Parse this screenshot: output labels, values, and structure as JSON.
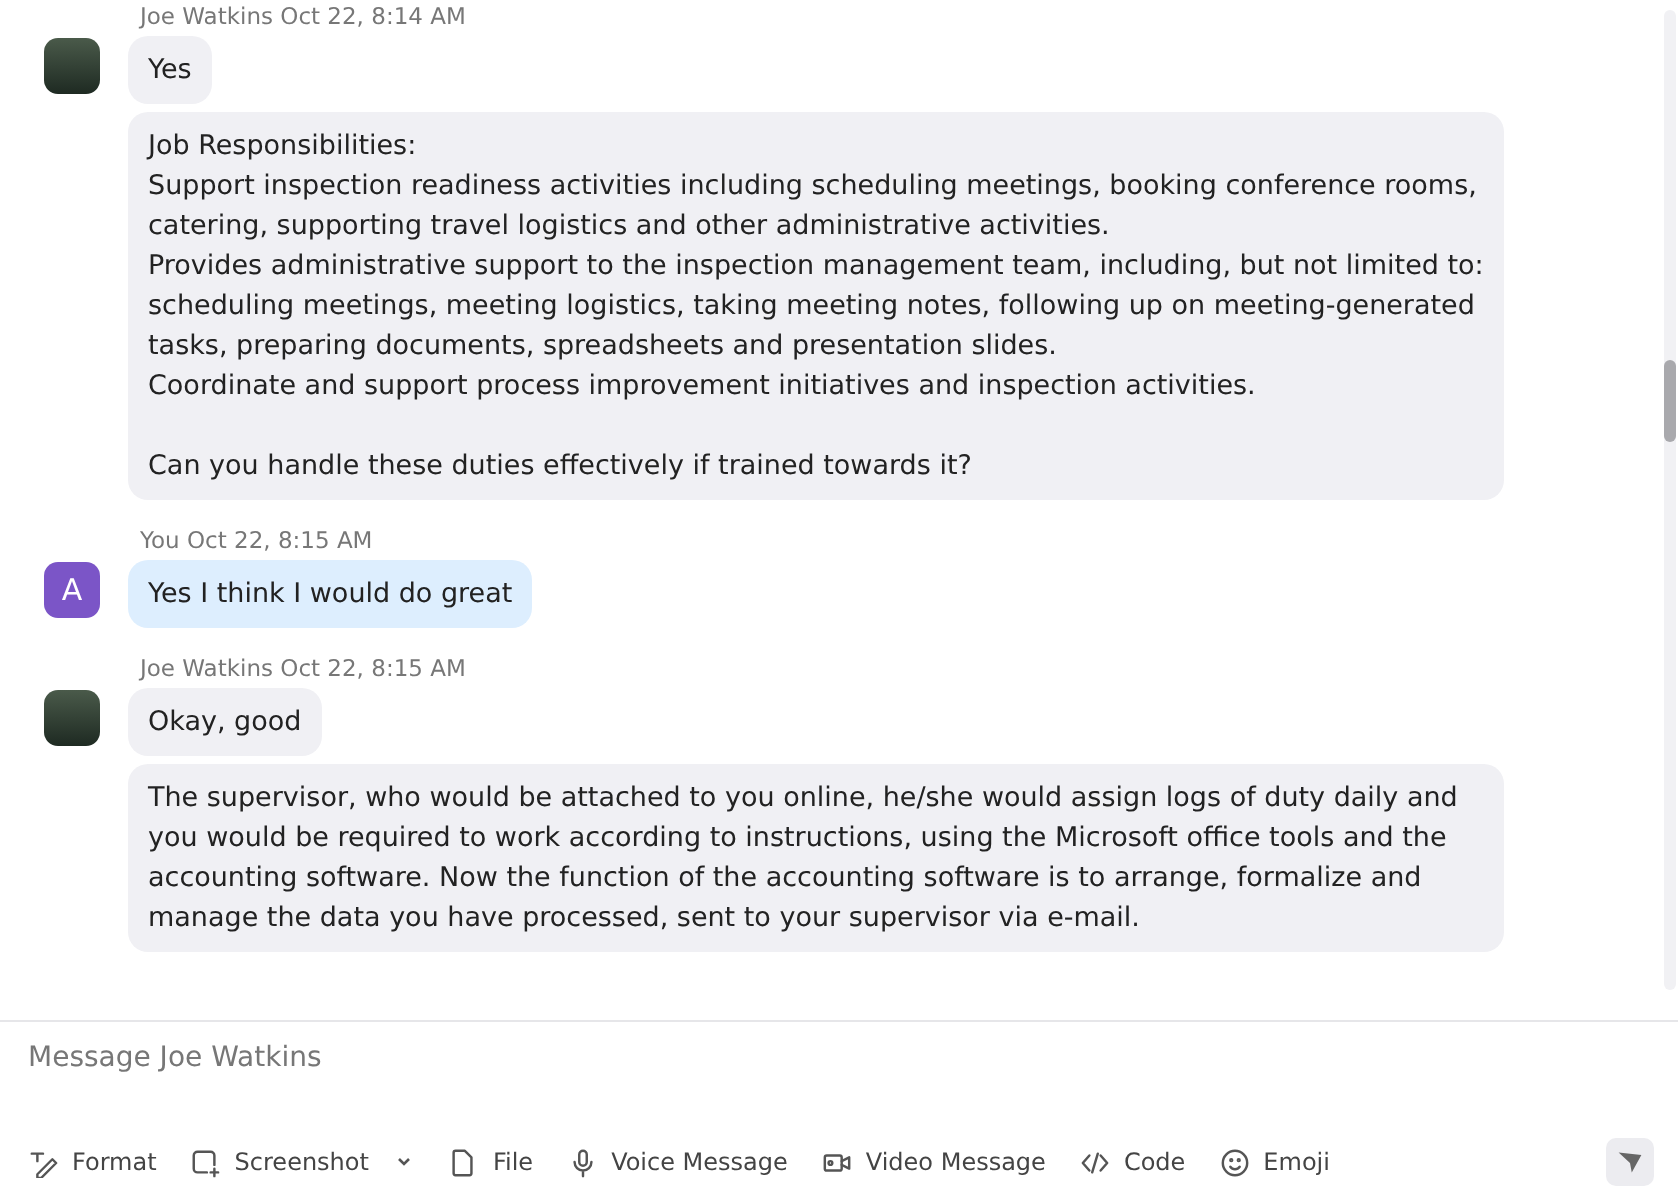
{
  "messages": [
    {
      "sender": "Joe Watkins",
      "time": "Oct 22, 8:14 AM",
      "avatar": {
        "kind": "photo"
      },
      "outgoing": false,
      "bubbles": [
        "Yes",
        "Job Responsibilities:\nSupport inspection readiness activities including scheduling meetings, booking conference rooms, catering, supporting travel logistics and other administrative activities.\nProvides administrative support to the inspection management team, including, but not limited to: scheduling meetings, meeting logistics, taking meeting notes, following up on meeting-generated tasks, preparing documents, spreadsheets and presentation slides.\nCoordinate and support process improvement initiatives and inspection activities.\n\nCan you handle these duties effectively if trained towards it?"
      ]
    },
    {
      "sender": "You",
      "time": "Oct 22, 8:15 AM",
      "avatar": {
        "kind": "initial",
        "letter": "A"
      },
      "outgoing": true,
      "bubbles": [
        "Yes I think I would do great"
      ]
    },
    {
      "sender": "Joe Watkins",
      "time": "Oct 22, 8:15 AM",
      "avatar": {
        "kind": "photo"
      },
      "outgoing": false,
      "bubbles": [
        "Okay, good",
        "The supervisor, who would be attached to you online, he/she would assign logs of duty daily and you would be required to work according to instructions, using the Microsoft office tools and the accounting software. Now the function of the accounting software is to arrange, formalize and manage the data you have processed, sent to your supervisor via e-mail."
      ]
    }
  ],
  "composer": {
    "placeholder": "Message Joe Watkins"
  },
  "toolbar": [
    {
      "kind": "format",
      "label": "Format"
    },
    {
      "kind": "screenshot",
      "label": "Screenshot"
    },
    {
      "kind": "file",
      "label": "File"
    },
    {
      "kind": "voice",
      "label": "Voice Message"
    },
    {
      "kind": "video",
      "label": "Video Message"
    },
    {
      "kind": "code",
      "label": "Code"
    },
    {
      "kind": "emoji",
      "label": "Emoji"
    }
  ]
}
